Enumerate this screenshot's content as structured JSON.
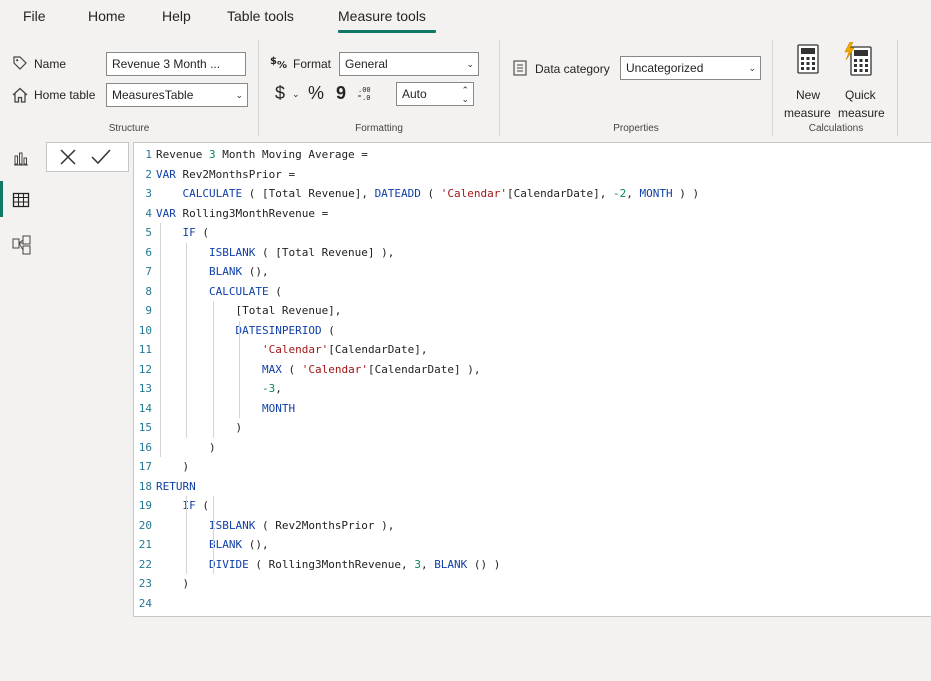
{
  "menu": {
    "tabs": [
      "File",
      "Home",
      "Help",
      "Table tools",
      "Measure tools"
    ],
    "active": "Measure tools"
  },
  "ribbon": {
    "structure": {
      "name_label": "Name",
      "name_value": "Revenue 3 Month ...",
      "home_table_label": "Home table",
      "home_table_value": "MeasuresTable",
      "group_label": "Structure"
    },
    "formatting": {
      "format_label": "Format",
      "format_value": "General",
      "currency_symbol": "$",
      "percent_symbol": "%",
      "comma_symbol": "9",
      "decimal_value": "Auto",
      "group_label": "Formatting"
    },
    "properties": {
      "data_category_label": "Data category",
      "data_category_value": "Uncategorized",
      "group_label": "Properties"
    },
    "calculations": {
      "new_measure_line1": "New",
      "new_measure_line2": "measure",
      "quick_measure_line1": "Quick",
      "quick_measure_line2": "measure",
      "group_label": "Calculations"
    }
  },
  "editor": {
    "lines": [
      "Revenue 3 Month Moving Average =",
      "VAR Rev2MonthsPrior =",
      "    CALCULATE ( [Total Revenue], DATEADD ( 'Calendar'[CalendarDate], -2, MONTH ) )",
      "VAR Rolling3MonthRevenue =",
      "    IF (",
      "        ISBLANK ( [Total Revenue] ),",
      "        BLANK (),",
      "        CALCULATE (",
      "            [Total Revenue],",
      "            DATESINPERIOD (",
      "                'Calendar'[CalendarDate],",
      "                MAX ( 'Calendar'[CalendarDate] ),",
      "                -3,",
      "                MONTH",
      "            )",
      "        )",
      "    )",
      "RETURN",
      "    IF (",
      "        ISBLANK ( Rev2MonthsPrior ),",
      "        BLANK (),",
      "        DIVIDE ( Rolling3MonthRevenue, 3, BLANK () )",
      "    )",
      ""
    ]
  },
  "colors": {
    "accent": "#117865",
    "keyword": "#0f3fa6",
    "string": "#a31515",
    "number": "#098658",
    "line_number": "#237893"
  }
}
